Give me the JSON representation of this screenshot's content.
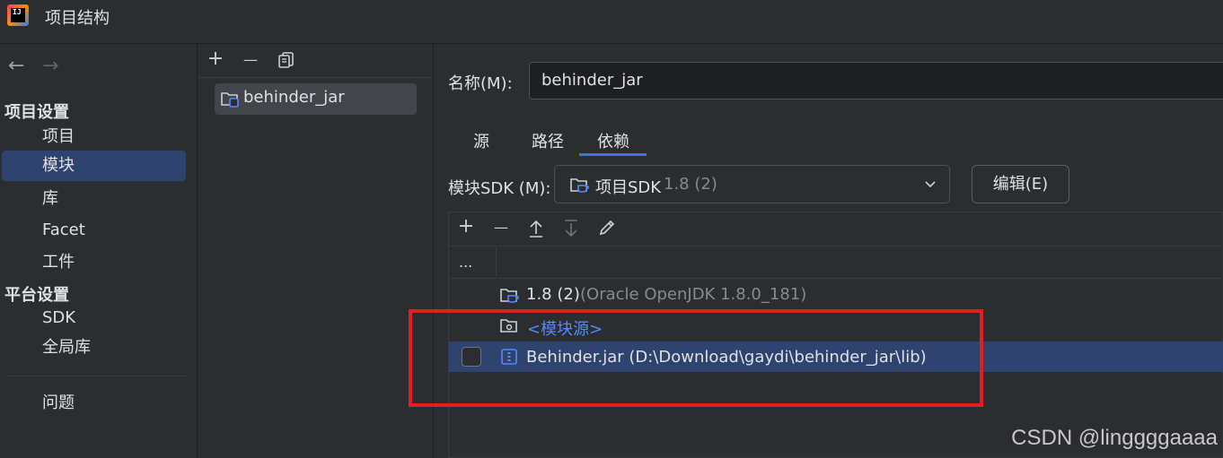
{
  "window": {
    "title": "项目结构"
  },
  "nav": {
    "back_arrow": "←",
    "forward_arrow": "→",
    "project_settings_title": "项目设置",
    "platform_settings_title": "平台设置",
    "project_settings_items": [
      "项目",
      "模块",
      "库",
      "Facet",
      "工件"
    ],
    "platform_settings_items": [
      "SDK",
      "全局库"
    ],
    "problems_item": "问题",
    "selected_item": "模块"
  },
  "modules": {
    "toolbar": {
      "add": "+",
      "remove": "—",
      "copy": "copy-icon"
    },
    "items": [
      "behinder_jar"
    ]
  },
  "details": {
    "name_label": "名称(M):",
    "name_value": "behinder_jar",
    "tabs": [
      "源",
      "路径",
      "依赖"
    ],
    "active_tab": "依赖",
    "sdk_label": "模块SDK (M):",
    "sdk_value": "项目SDK",
    "sdk_version": "1.8 (2)",
    "edit_button": "编辑(E)",
    "dep_toolbar": {
      "add": "+",
      "remove": "—",
      "move_up": "↑",
      "move_down": "↓",
      "edit": "✎"
    },
    "table_header_col1": "...",
    "rows": [
      {
        "name": "1.8 (2)",
        "detail": "(Oracle OpenJDK 1.8.0_181)",
        "icon": "jdk-folder-icon"
      },
      {
        "name": "<模块源>",
        "detail": "",
        "icon": "module-source-folder-icon"
      },
      {
        "name": "Behinder.jar (D:\\Download\\gaydi\\behinder_jar\\lib)",
        "detail": "",
        "icon": "jar-icon",
        "selected": true,
        "checked": false
      }
    ]
  },
  "watermark": "CSDN @linggggaaaa",
  "colors": {
    "accent": "#3574f0",
    "selection": "#2e436e",
    "highlight_box": "#e02020",
    "link": "#548af7"
  }
}
